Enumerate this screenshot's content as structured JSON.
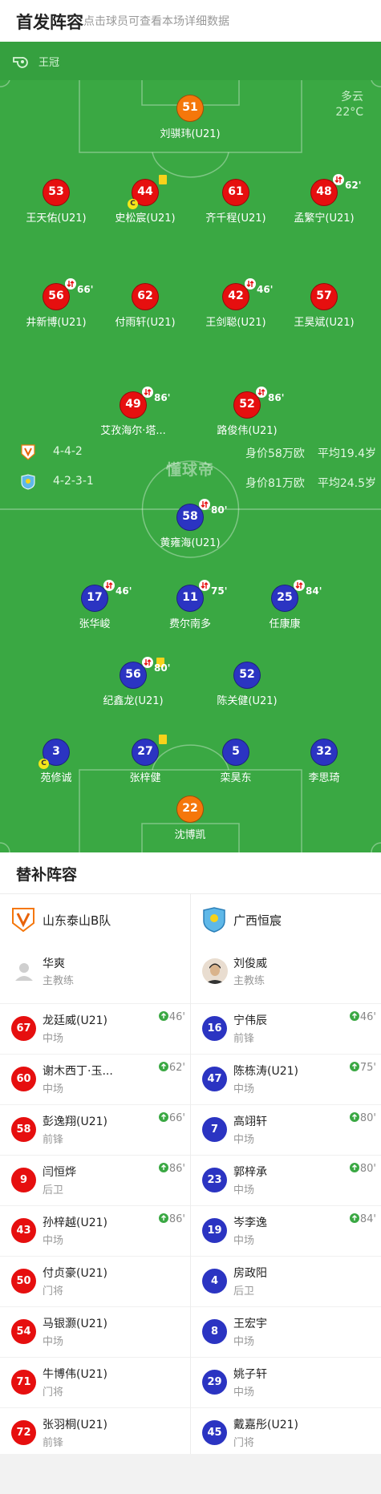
{
  "header": {
    "title": "首发阵容",
    "subtitle": "点击球员可查看本场详细数据"
  },
  "pitch": {
    "referee": "王冠",
    "weather": {
      "condition": "多云",
      "temperature": "22°C"
    },
    "watermark": "懂球帝",
    "home_team_info": {
      "formation": "4-4-2",
      "value": "身价58万欧",
      "avg_age": "平均19.4岁"
    },
    "away_team_info": {
      "formation": "4-2-3-1",
      "value": "身价81万欧",
      "avg_age": "平均24.5岁"
    },
    "home_players": [
      {
        "num": "51",
        "name": "刘骐玮(U21)",
        "gk": true
      },
      {
        "num": "53",
        "name": "王天佑(U21)"
      },
      {
        "num": "44",
        "name": "史松宸(U21)",
        "yellow": true,
        "captain": "C"
      },
      {
        "num": "61",
        "name": "齐千程(U21)"
      },
      {
        "num": "48",
        "name": "孟繁宁(U21)",
        "sub_min": "62'"
      },
      {
        "num": "56",
        "name": "井新博(U21)",
        "sub_min": "66'"
      },
      {
        "num": "62",
        "name": "付雨轩(U21)"
      },
      {
        "num": "42",
        "name": "王剑聪(U21)",
        "sub_min": "46'"
      },
      {
        "num": "57",
        "name": "王昊斌(U21)"
      },
      {
        "num": "49",
        "name": "艾孜海尔·塔...",
        "sub_min": "86'"
      },
      {
        "num": "52",
        "name": "路俊伟(U21)",
        "sub_min": "86'"
      }
    ],
    "away_players": [
      {
        "num": "58",
        "name": "黄雍海(U21)",
        "sub_min": "80'"
      },
      {
        "num": "17",
        "name": "张华峻",
        "sub_min": "46'"
      },
      {
        "num": "11",
        "name": "费尔南多",
        "sub_min": "75'"
      },
      {
        "num": "25",
        "name": "任康康",
        "sub_min": "84'"
      },
      {
        "num": "56",
        "name": "纪鑫龙(U21)",
        "yellow": true,
        "sub_min": "80'"
      },
      {
        "num": "52",
        "name": "陈关健(U21)"
      },
      {
        "num": "3",
        "name": "苑修诚",
        "captain": "C"
      },
      {
        "num": "27",
        "name": "张梓健",
        "yellow": true
      },
      {
        "num": "5",
        "name": "栾昊东"
      },
      {
        "num": "32",
        "name": "李思琦"
      },
      {
        "num": "22",
        "name": "沈博凯",
        "gk": true
      }
    ]
  },
  "subs": {
    "title": "替补阵容",
    "home": {
      "team": "山东泰山B队",
      "coach": {
        "name": "华爽",
        "role": "主教练"
      },
      "players": [
        {
          "num": "67",
          "name": "龙廷威(U21)",
          "pos": "中场",
          "in": "46'"
        },
        {
          "num": "60",
          "name": "谢木西丁·玉...",
          "pos": "中场",
          "in": "62'"
        },
        {
          "num": "58",
          "name": "彭逸翔(U21)",
          "pos": "前锋",
          "in": "66'"
        },
        {
          "num": "9",
          "name": "闫恒烨",
          "pos": "后卫",
          "in": "86'"
        },
        {
          "num": "43",
          "name": "孙梓越(U21)",
          "pos": "中场",
          "in": "86'"
        },
        {
          "num": "50",
          "name": "付贞豪(U21)",
          "pos": "门将"
        },
        {
          "num": "54",
          "name": "马银灏(U21)",
          "pos": "中场"
        },
        {
          "num": "71",
          "name": "牛博伟(U21)",
          "pos": "门将"
        },
        {
          "num": "72",
          "name": "张羽桐(U21)",
          "pos": "前锋"
        }
      ]
    },
    "away": {
      "team": "广西恒宸",
      "coach": {
        "name": "刘俊威",
        "role": "主教练"
      },
      "players": [
        {
          "num": "16",
          "name": "宁伟辰",
          "pos": "前锋",
          "in": "46'"
        },
        {
          "num": "47",
          "name": "陈栋涛(U21)",
          "pos": "中场",
          "in": "75'"
        },
        {
          "num": "7",
          "name": "高翊轩",
          "pos": "中场",
          "in": "80'"
        },
        {
          "num": "23",
          "name": "郭梓承",
          "pos": "中场",
          "in": "80'"
        },
        {
          "num": "19",
          "name": "岑李逸",
          "pos": "中场",
          "in": "84'"
        },
        {
          "num": "4",
          "name": "房政阳",
          "pos": "后卫"
        },
        {
          "num": "8",
          "name": "王宏宇",
          "pos": "中场"
        },
        {
          "num": "29",
          "name": "姚子轩",
          "pos": "中场"
        },
        {
          "num": "45",
          "name": "戴嘉彤(U21)",
          "pos": "门将"
        }
      ]
    }
  }
}
